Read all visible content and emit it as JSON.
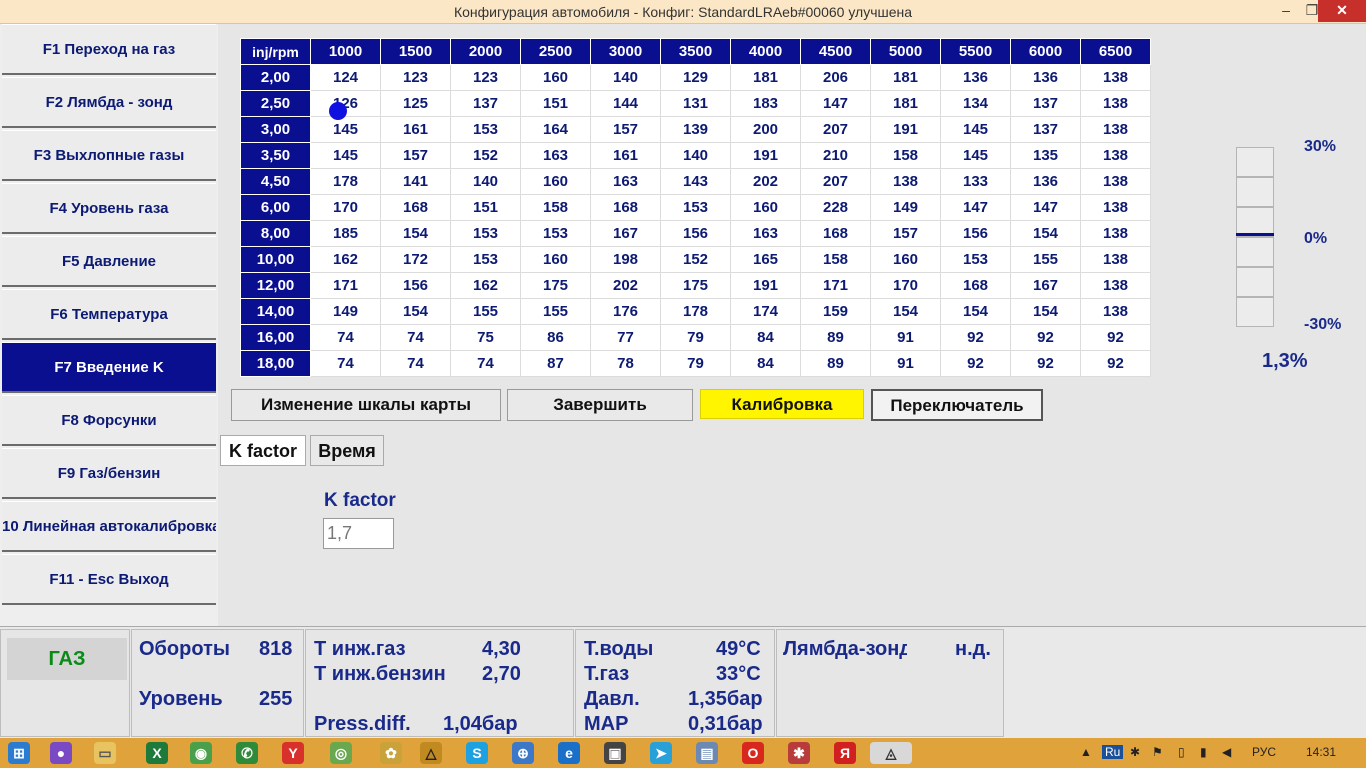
{
  "window": {
    "title": "Конфигурация автомобиля - Конфиг: StandardLRAeb#00060 улучшена",
    "min": "–",
    "max": "❐",
    "close": "✕"
  },
  "sidebar": {
    "items": [
      {
        "label": "F1 Переход на газ"
      },
      {
        "label": "F2 Лямбда - зонд"
      },
      {
        "label": "F3 Выхлопные газы"
      },
      {
        "label": "F4 Уровень газа"
      },
      {
        "label": "F5 Давление"
      },
      {
        "label": "F6 Температура"
      },
      {
        "label": "F7 Введение K",
        "active": true
      },
      {
        "label": "F8 Форсунки"
      },
      {
        "label": "F9 Газ/бензин"
      },
      {
        "label": "10 Линейная автокалибровка"
      },
      {
        "label": "F11 - Esc Выход"
      }
    ]
  },
  "map": {
    "corner": "inj/rpm",
    "columns": [
      "1000",
      "1500",
      "2000",
      "2500",
      "3000",
      "3500",
      "4000",
      "4500",
      "5000",
      "5500",
      "6000",
      "6500"
    ],
    "rows": [
      {
        "h": "2,00",
        "v": [
          "124",
          "123",
          "123",
          "160",
          "140",
          "129",
          "181",
          "206",
          "181",
          "136",
          "136",
          "138"
        ]
      },
      {
        "h": "2,50",
        "v": [
          "126",
          "125",
          "137",
          "151",
          "144",
          "131",
          "183",
          "147",
          "181",
          "134",
          "137",
          "138"
        ]
      },
      {
        "h": "3,00",
        "v": [
          "145",
          "161",
          "153",
          "164",
          "157",
          "139",
          "200",
          "207",
          "191",
          "145",
          "137",
          "138"
        ]
      },
      {
        "h": "3,50",
        "v": [
          "145",
          "157",
          "152",
          "163",
          "161",
          "140",
          "191",
          "210",
          "158",
          "145",
          "135",
          "138"
        ]
      },
      {
        "h": "4,50",
        "v": [
          "178",
          "141",
          "140",
          "160",
          "163",
          "143",
          "202",
          "207",
          "138",
          "133",
          "136",
          "138"
        ]
      },
      {
        "h": "6,00",
        "v": [
          "170",
          "168",
          "151",
          "158",
          "168",
          "153",
          "160",
          "228",
          "149",
          "147",
          "147",
          "138"
        ]
      },
      {
        "h": "8,00",
        "v": [
          "185",
          "154",
          "153",
          "153",
          "167",
          "156",
          "163",
          "168",
          "157",
          "156",
          "154",
          "138"
        ]
      },
      {
        "h": "10,00",
        "v": [
          "162",
          "172",
          "153",
          "160",
          "198",
          "152",
          "165",
          "158",
          "160",
          "153",
          "155",
          "138"
        ]
      },
      {
        "h": "12,00",
        "v": [
          "171",
          "156",
          "162",
          "175",
          "202",
          "175",
          "191",
          "171",
          "170",
          "168",
          "167",
          "138"
        ]
      },
      {
        "h": "14,00",
        "v": [
          "149",
          "154",
          "155",
          "155",
          "176",
          "178",
          "174",
          "159",
          "154",
          "154",
          "154",
          "138"
        ]
      },
      {
        "h": "16,00",
        "v": [
          "74",
          "74",
          "75",
          "86",
          "77",
          "79",
          "84",
          "89",
          "91",
          "92",
          "92",
          "92"
        ]
      },
      {
        "h": "18,00",
        "v": [
          "74",
          "74",
          "74",
          "87",
          "78",
          "79",
          "84",
          "89",
          "91",
          "92",
          "92",
          "92"
        ]
      }
    ]
  },
  "buttons": {
    "scale": "Изменение шкалы карты",
    "finish": "Завершить",
    "calib": "Калибровка",
    "switch": "Переключатель"
  },
  "tabs": {
    "kfactor": "K factor",
    "time": "Время"
  },
  "kfactor": {
    "label": "K factor",
    "value": "1,7"
  },
  "gauge": {
    "top": "30%",
    "mid": "0%",
    "bottom": "-30%",
    "value": "1,3%"
  },
  "status": {
    "mode": "ГАЗ",
    "rpm_label": "Обороты",
    "rpm": "818",
    "level_label": "Уровень",
    "level": "255",
    "tinj_gas_label": "Т инж.газ",
    "tinj_gas": "4,30",
    "tinj_petrol_label": "Т инж.бензин",
    "tinj_petrol": "2,70",
    "press_label": "Press.diff.",
    "press": "1,04бар",
    "water_label": "Т.воды",
    "water": "49°C",
    "gas_t_label": "Т.газ",
    "gas_t": "33°C",
    "pressure_label": "Давл.",
    "pressure": "1,35бар",
    "map_label": "MAP",
    "map": "0,31бар",
    "lambda_label": "Лямбда-зонд",
    "lambda": "н.д."
  },
  "taskbar": {
    "lang": "Ru",
    "kbd": "РУС",
    "time": "14:31",
    "color": "#e0a23a"
  }
}
